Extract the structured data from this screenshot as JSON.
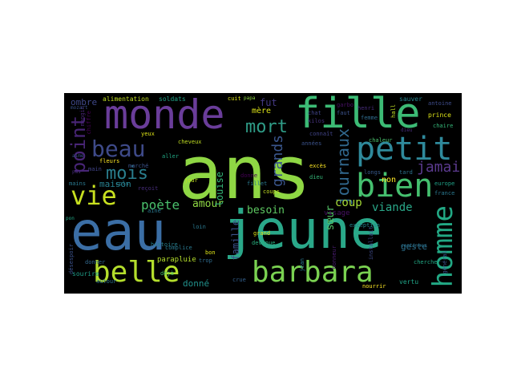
{
  "colors": {
    "background": "#000000",
    "page": "#ffffff"
  },
  "words": [
    {
      "text": "ans",
      "color": "#8fd744"
    },
    {
      "text": "eau",
      "color": "#3b6ea5"
    },
    {
      "text": "jeune",
      "color": "#2aa889"
    },
    {
      "text": "monde",
      "color": "#6a3d9a"
    },
    {
      "text": "fille",
      "color": "#3cbb75"
    },
    {
      "text": "petit",
      "color": "#2f8a9c"
    },
    {
      "text": "bien",
      "color": "#45c06f"
    },
    {
      "text": "barbara",
      "color": "#7ad151"
    },
    {
      "text": "belle",
      "color": "#b4de2c"
    },
    {
      "text": "homme",
      "color": "#22a884"
    },
    {
      "text": "vie",
      "color": "#c8e020"
    },
    {
      "text": "beau",
      "color": "#3e4a89"
    },
    {
      "text": "mois",
      "color": "#2a7e8e"
    },
    {
      "text": "mort",
      "color": "#2f9c87"
    },
    {
      "text": "point",
      "color": "#482576"
    },
    {
      "text": "jamais",
      "color": "#5b3a8e"
    },
    {
      "text": "journaux",
      "color": "#31688e"
    },
    {
      "text": "grands",
      "color": "#3a568c"
    },
    {
      "text": "poète",
      "color": "#4ac16d"
    },
    {
      "text": "amour",
      "color": "#8fd744"
    },
    {
      "text": "besoin",
      "color": "#5ec962"
    },
    {
      "text": "coup",
      "color": "#a5db36"
    },
    {
      "text": "viande",
      "color": "#2aa889"
    },
    {
      "text": "fut",
      "color": "#443a83"
    },
    {
      "text": "mère",
      "color": "#dde318"
    },
    {
      "text": "ombre",
      "color": "#3f4889"
    },
    {
      "text": "maison",
      "color": "#277f8e"
    },
    {
      "text": "louise",
      "color": "#35b779"
    },
    {
      "text": "famille",
      "color": "#3b528b"
    },
    {
      "text": "geste",
      "color": "#2c718e"
    },
    {
      "text": "sœur",
      "color": "#54c568"
    },
    {
      "text": "non",
      "color": "#fde725"
    },
    {
      "text": "donné",
      "color": "#21918c"
    },
    {
      "text": "alimentation",
      "color": "#c2df23"
    },
    {
      "text": "soldats",
      "color": "#20a386"
    },
    {
      "text": "cuit",
      "color": "#dde318"
    },
    {
      "text": "garbo",
      "color": "#471164"
    },
    {
      "text": "antoine",
      "color": "#3e4c8a"
    },
    {
      "text": "sauver",
      "color": "#25848e"
    },
    {
      "text": "prince",
      "color": "#dde318"
    },
    {
      "text": "chaire",
      "color": "#35b779"
    },
    {
      "text": "chat",
      "color": "#404387"
    },
    {
      "text": "faut",
      "color": "#3b528b"
    },
    {
      "text": "femme",
      "color": "#2f6b8e"
    },
    {
      "text": "kilos",
      "color": "#46327e"
    },
    {
      "text": "hall",
      "color": "#c2df23"
    },
    {
      "text": "chaleur",
      "color": "#4ac16d"
    },
    {
      "text": "excès",
      "color": "#fde725"
    },
    {
      "text": "dieu",
      "color": "#35b779"
    },
    {
      "text": "longs",
      "color": "#38598c"
    },
    {
      "text": "tard",
      "color": "#2c728e"
    },
    {
      "text": "europe",
      "color": "#1fa187"
    },
    {
      "text": "france",
      "color": "#2a788e"
    },
    {
      "text": "visage",
      "color": "#471164"
    },
    {
      "text": "coups",
      "color": "#c2df23"
    },
    {
      "text": "exception",
      "color": "#24868e"
    },
    {
      "text": "parapluie",
      "color": "#b4de2c"
    },
    {
      "text": "grand",
      "color": "#dde318"
    },
    {
      "text": "devenue",
      "color": "#29af7f"
    },
    {
      "text": "crue",
      "color": "#34608d"
    },
    {
      "text": "honneur",
      "color": "#481c6e"
    },
    {
      "text": "vertu",
      "color": "#20a386"
    },
    {
      "text": "installait",
      "color": "#3e4a89"
    },
    {
      "text": "chercher",
      "color": "#22a884"
    },
    {
      "text": "jour",
      "color": "#c2df23"
    },
    {
      "text": "bon",
      "color": "#dde318"
    },
    {
      "text": "déjà",
      "color": "#4ac16d"
    },
    {
      "text": "sourire",
      "color": "#1f9e89"
    },
    {
      "text": "désespoir",
      "color": "#3b528b"
    },
    {
      "text": "histoire",
      "color": "#277f8e"
    },
    {
      "text": "trop",
      "color": "#2f6b8e"
    },
    {
      "text": "main",
      "color": "#404387"
    },
    {
      "text": "mains",
      "color": "#2a788e"
    },
    {
      "text": "yeux",
      "color": "#dde318"
    },
    {
      "text": "cheveux",
      "color": "#c2df23"
    },
    {
      "text": "fleurs",
      "color": "#fde725"
    },
    {
      "text": "marché",
      "color": "#3b528b"
    },
    {
      "text": "reçoit",
      "color": "#472d7b"
    },
    {
      "text": "aîné",
      "color": "#2a788e"
    },
    {
      "text": "cols",
      "color": "#277f8e"
    },
    {
      "text": "aller",
      "color": "#22a884"
    },
    {
      "text": "donne",
      "color": "#440154"
    },
    {
      "text": "fillet",
      "color": "#2a788e"
    },
    {
      "text": "mangin",
      "color": "#482475"
    },
    {
      "text": "papa",
      "color": "#8fd744"
    },
    {
      "text": "années",
      "color": "#3b528b"
    },
    {
      "text": "complice",
      "color": "#2a788e"
    },
    {
      "text": "donner",
      "color": "#31688e"
    },
    {
      "text": "autour",
      "color": "#2c728e"
    },
    {
      "text": "nourrir",
      "color": "#fde725"
    },
    {
      "text": "continuer",
      "color": "#2c728e"
    },
    {
      "text": "général",
      "color": "#3b528b"
    },
    {
      "text": "connaît",
      "color": "#404387"
    },
    {
      "text": "chiffre",
      "color": "#440154"
    },
    {
      "text": "henri",
      "color": "#472d7b"
    },
    {
      "text": "mozart",
      "color": "#3b528b"
    },
    {
      "text": "jean",
      "color": "#2a788e"
    },
    {
      "text": "loin",
      "color": "#2a788e"
    },
    {
      "text": "pon",
      "color": "#22a884"
    },
    {
      "text": "aime",
      "color": "#3b528b"
    },
    {
      "text": "pas",
      "color": "#472d7b"
    },
    {
      "text": "dieu",
      "color": "#472d7b"
    }
  ]
}
